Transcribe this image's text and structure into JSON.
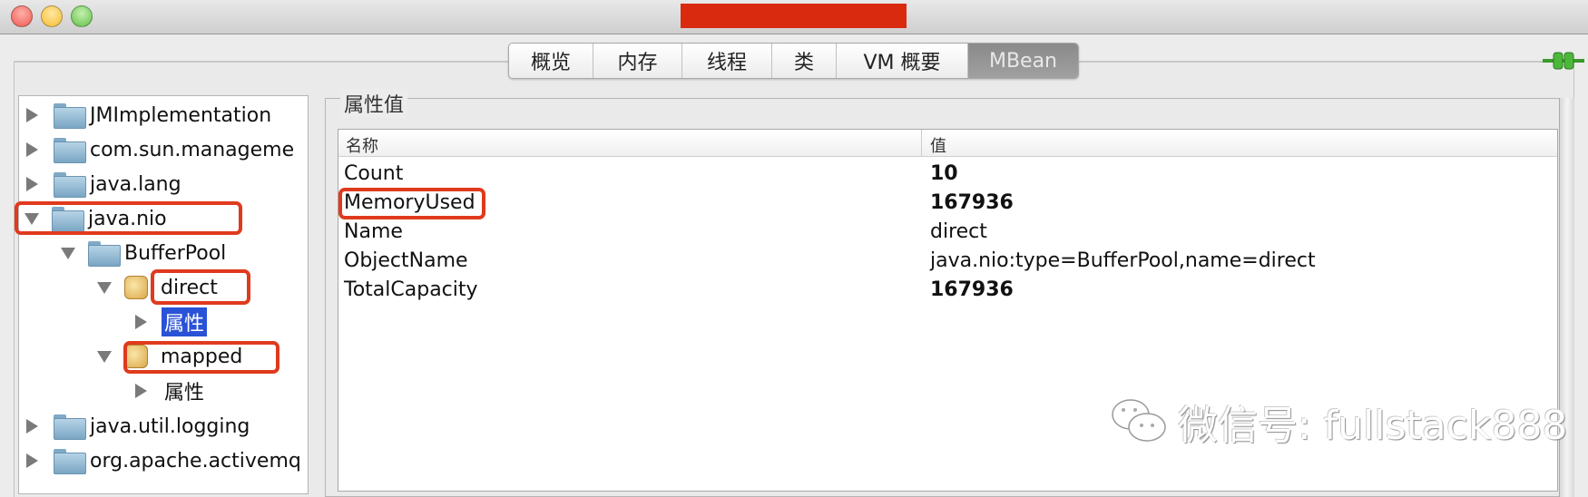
{
  "window": {
    "traffic_lights": {
      "close": "#ee5a52",
      "minimize": "#f5bd33",
      "zoom": "#5fc144"
    },
    "redaction_color": "#d92a10"
  },
  "tabs": [
    {
      "label": "概览"
    },
    {
      "label": "内存"
    },
    {
      "label": "线程"
    },
    {
      "label": "类"
    },
    {
      "label": "VM 概要"
    },
    {
      "label": "MBean",
      "active": true
    }
  ],
  "connection_icon": "green-plug-icon",
  "tree": [
    {
      "label": "JMImplementation",
      "expanded": false
    },
    {
      "label": "com.sun.manageme",
      "expanded": false
    },
    {
      "label": "java.lang",
      "expanded": false
    },
    {
      "label": "java.nio",
      "expanded": true
    },
    {
      "label": "BufferPool",
      "expanded": true
    },
    {
      "label": "direct",
      "expanded": true
    },
    {
      "label": "属性",
      "selected": true
    },
    {
      "label": "mapped",
      "expanded": true
    },
    {
      "label": "属性"
    },
    {
      "label": "java.util.logging",
      "expanded": false
    },
    {
      "label": "org.apache.activemq",
      "expanded": false
    }
  ],
  "attributes": {
    "legend": "属性值",
    "columns": [
      "名称",
      "值"
    ],
    "rows": [
      {
        "name": "Count",
        "value": "10",
        "bold": true
      },
      {
        "name": "MemoryUsed",
        "value": "167936",
        "bold": true
      },
      {
        "name": "Name",
        "value": "direct"
      },
      {
        "name": "ObjectName",
        "value": "java.nio:type=BufferPool,name=direct"
      },
      {
        "name": "TotalCapacity",
        "value": "167936",
        "bold": true
      }
    ]
  },
  "annotation_color": "#e03a1e",
  "watermark": "微信号: fullstack888"
}
